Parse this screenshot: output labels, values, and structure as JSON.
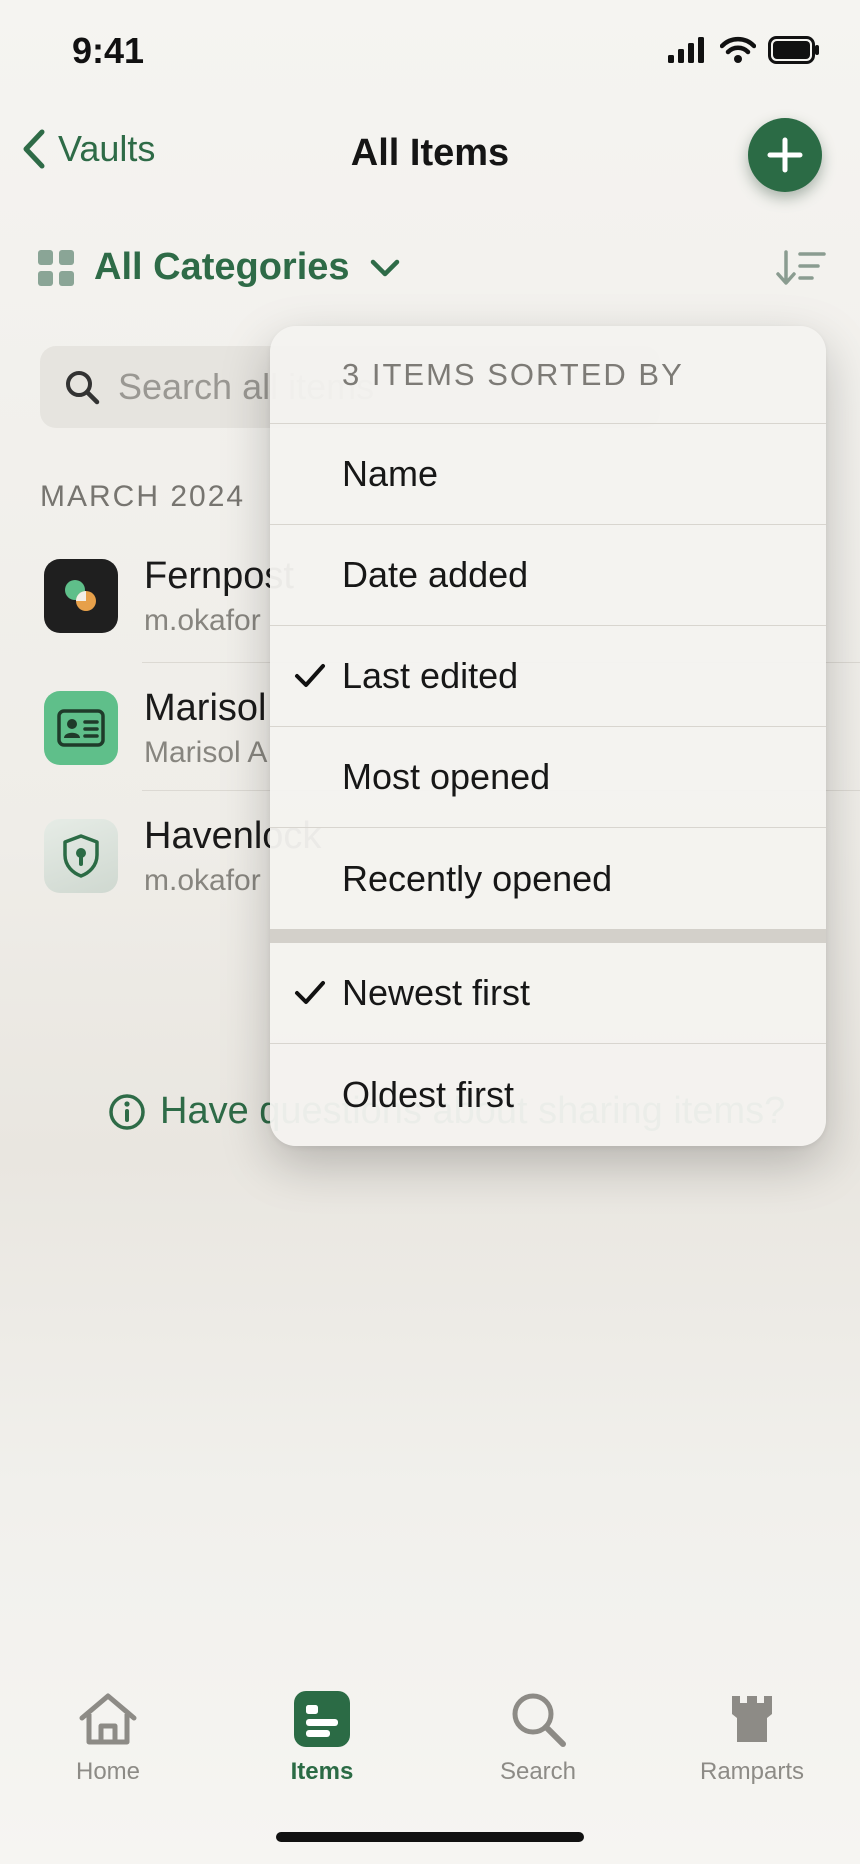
{
  "status": {
    "time": "9:41"
  },
  "nav": {
    "back_label": "Vaults",
    "title": "All Items"
  },
  "categories": {
    "label": "All Categories"
  },
  "search": {
    "placeholder": "Search all items"
  },
  "section_header": "MARCH 2024",
  "items": [
    {
      "title": "Fernpost",
      "subtitle": "m.okafor"
    },
    {
      "title": "Marisol",
      "subtitle": "Marisol A"
    },
    {
      "title": "Havenlock",
      "subtitle": "m.okafor"
    }
  ],
  "help_text": "Have questions about sharing items?",
  "sort_menu": {
    "header": "3 ITEMS SORTED BY",
    "sort_by": [
      {
        "label": "Name",
        "checked": false
      },
      {
        "label": "Date added",
        "checked": false
      },
      {
        "label": "Last edited",
        "checked": true
      },
      {
        "label": "Most opened",
        "checked": false
      },
      {
        "label": "Recently opened",
        "checked": false
      }
    ],
    "order": [
      {
        "label": "Newest first",
        "checked": true
      },
      {
        "label": "Oldest first",
        "checked": false
      }
    ]
  },
  "tabs": [
    {
      "label": "Home",
      "icon": "house-icon",
      "active": false
    },
    {
      "label": "Items",
      "icon": "items-icon",
      "active": true
    },
    {
      "label": "Search",
      "icon": "magnifier-icon",
      "active": false
    },
    {
      "label": "Ramparts",
      "icon": "castle-icon",
      "active": false
    }
  ],
  "colors": {
    "accent": "#2b6b45",
    "background": "#f3f2ee"
  }
}
